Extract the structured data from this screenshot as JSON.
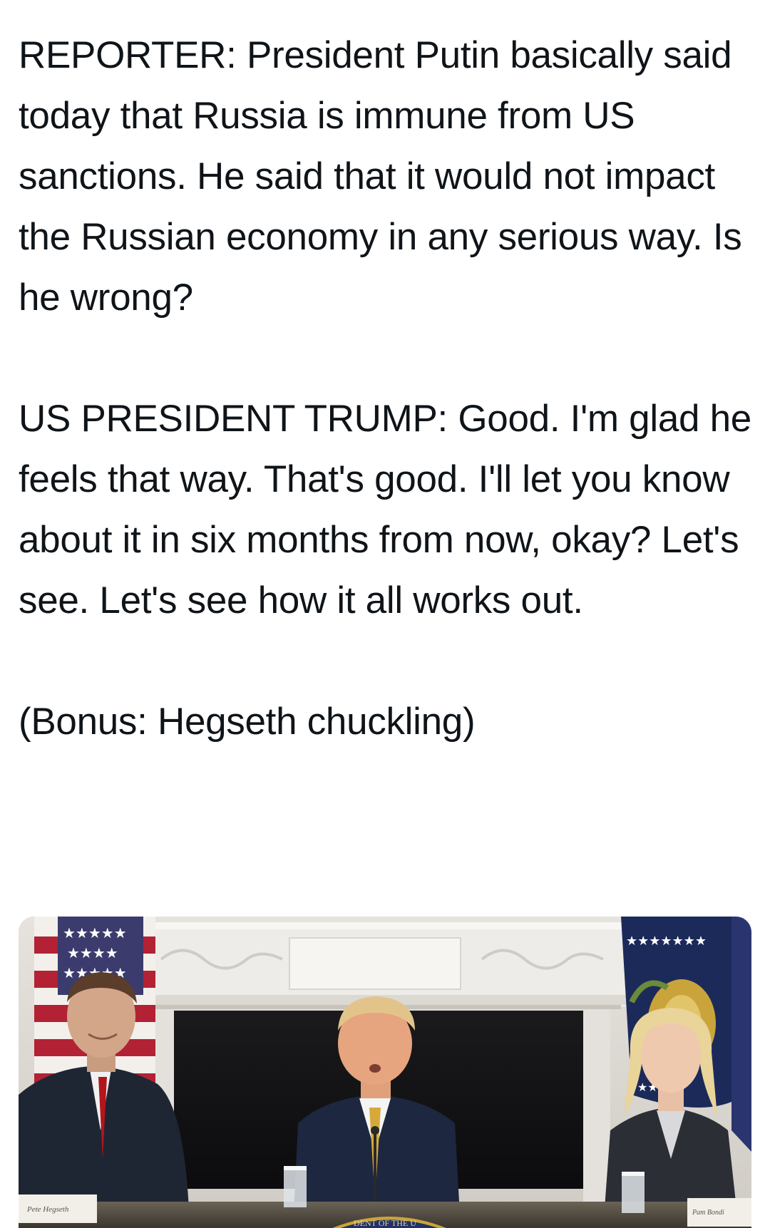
{
  "post": {
    "paragraphs": [
      "REPORTER: President Putin basically said today that Russia is immune from US sanctions. He said that it would not impact the Russian economy in any serious way. Is he wrong?",
      "US PRESIDENT TRUMP: Good. I'm glad he feels that way. That's good. I'll let you know about it in six months from now, okay? Let's see. Let's see how it all works out.",
      "(Bonus: Hegseth chuckling)"
    ]
  },
  "media": {
    "type": "photo",
    "placards": {
      "left": "Pete Hegseth",
      "right": "Pam Bondi"
    },
    "seal_text": "DENT OF THE U"
  },
  "colors": {
    "text": "#0f1419",
    "background": "#ffffff",
    "flag_red": "#b22234",
    "flag_blue": "#3c3b6e",
    "navy_flag": "#1c2a5a",
    "gold": "#c9a43a"
  }
}
